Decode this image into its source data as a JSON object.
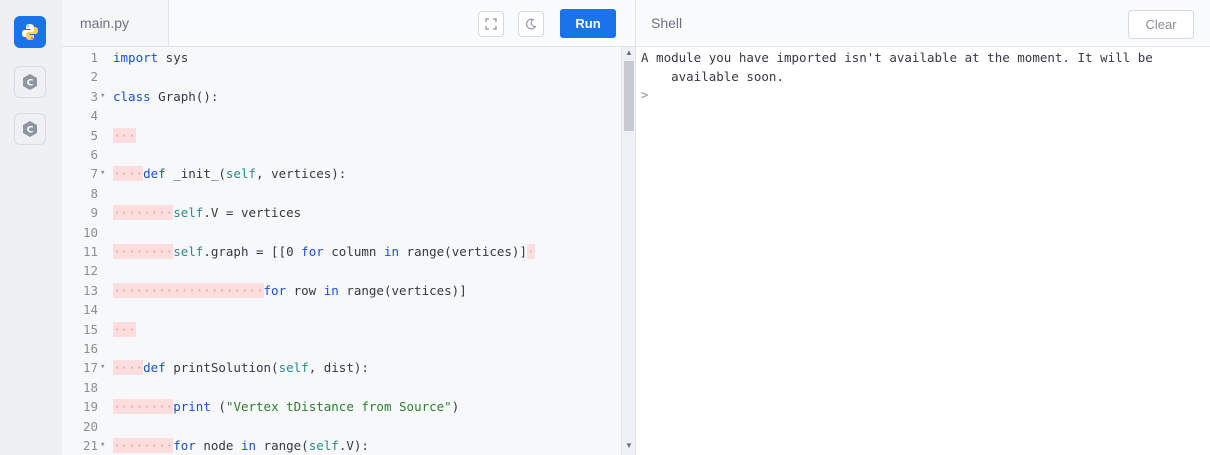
{
  "rail": {
    "icons": [
      "python-icon",
      "c-language-icon",
      "c-language-icon"
    ]
  },
  "editor": {
    "tab_label": "main.py",
    "run_label": "Run",
    "lines": [
      {
        "n": "1",
        "fold": "",
        "ws": "",
        "tokens": [
          [
            "kw",
            "import"
          ],
          [
            "p",
            " sys"
          ]
        ]
      },
      {
        "n": "2",
        "fold": "",
        "ws": "",
        "tokens": []
      },
      {
        "n": "3",
        "fold": "▾",
        "ws": "",
        "tokens": [
          [
            "kw",
            "class"
          ],
          [
            "p",
            " Graph():"
          ]
        ]
      },
      {
        "n": "4",
        "fold": "",
        "ws": "",
        "tokens": []
      },
      {
        "n": "5",
        "fold": "",
        "ws": "···",
        "tokens": []
      },
      {
        "n": "6",
        "fold": "",
        "ws": "",
        "tokens": []
      },
      {
        "n": "7",
        "fold": "▾",
        "ws": "····",
        "tokens": [
          [
            "kw",
            "def"
          ],
          [
            "p",
            " _init_("
          ],
          [
            "self",
            "self"
          ],
          [
            "p",
            ", vertices):"
          ]
        ]
      },
      {
        "n": "8",
        "fold": "",
        "ws": "",
        "tokens": []
      },
      {
        "n": "9",
        "fold": "",
        "ws": "········",
        "tokens": [
          [
            "self",
            "self"
          ],
          [
            "p",
            ".V = vertices"
          ]
        ]
      },
      {
        "n": "10",
        "fold": "",
        "ws": "",
        "tokens": []
      },
      {
        "n": "11",
        "fold": "",
        "ws": "········",
        "tokens": [
          [
            "self",
            "self"
          ],
          [
            "p",
            ".graph = [[0 "
          ],
          [
            "kw",
            "for"
          ],
          [
            "p",
            " column "
          ],
          [
            "kw",
            "in"
          ],
          [
            "p",
            " range(vertices)]"
          ],
          [
            "ws",
            "·"
          ]
        ]
      },
      {
        "n": "12",
        "fold": "",
        "ws": "",
        "tokens": []
      },
      {
        "n": "13",
        "fold": "",
        "ws": "····················",
        "tokens": [
          [
            "kw",
            "for"
          ],
          [
            "p",
            " row "
          ],
          [
            "kw",
            "in"
          ],
          [
            "p",
            " range(vertices)]"
          ]
        ]
      },
      {
        "n": "14",
        "fold": "",
        "ws": "",
        "tokens": []
      },
      {
        "n": "15",
        "fold": "",
        "ws": "···",
        "tokens": []
      },
      {
        "n": "16",
        "fold": "",
        "ws": "",
        "tokens": []
      },
      {
        "n": "17",
        "fold": "▾",
        "ws": "····",
        "tokens": [
          [
            "kw",
            "def"
          ],
          [
            "p",
            " printSolution("
          ],
          [
            "self",
            "self"
          ],
          [
            "p",
            ", dist):"
          ]
        ]
      },
      {
        "n": "18",
        "fold": "",
        "ws": "",
        "tokens": []
      },
      {
        "n": "19",
        "fold": "",
        "ws": "········",
        "tokens": [
          [
            "kw",
            "print"
          ],
          [
            "p",
            " ("
          ],
          [
            "str",
            "\"Vertex tDistance from Source\""
          ],
          [
            "p",
            ")"
          ]
        ]
      },
      {
        "n": "20",
        "fold": "",
        "ws": "",
        "tokens": []
      },
      {
        "n": "21",
        "fold": "▾",
        "ws": "········",
        "tokens": [
          [
            "kw",
            "for"
          ],
          [
            "p",
            " node "
          ],
          [
            "kw",
            "in"
          ],
          [
            "p",
            " range("
          ],
          [
            "self",
            "self"
          ],
          [
            "p",
            ".V):"
          ]
        ]
      }
    ]
  },
  "shell": {
    "title": "Shell",
    "clear_label": "Clear",
    "output": "A module you have imported isn't available at the moment. It will be\n    available soon.",
    "prompt": ">"
  },
  "colors": {
    "accent": "#1a73e8",
    "highlight_bar": "#7b61e8",
    "whitespace_marker": "#fcdede"
  }
}
